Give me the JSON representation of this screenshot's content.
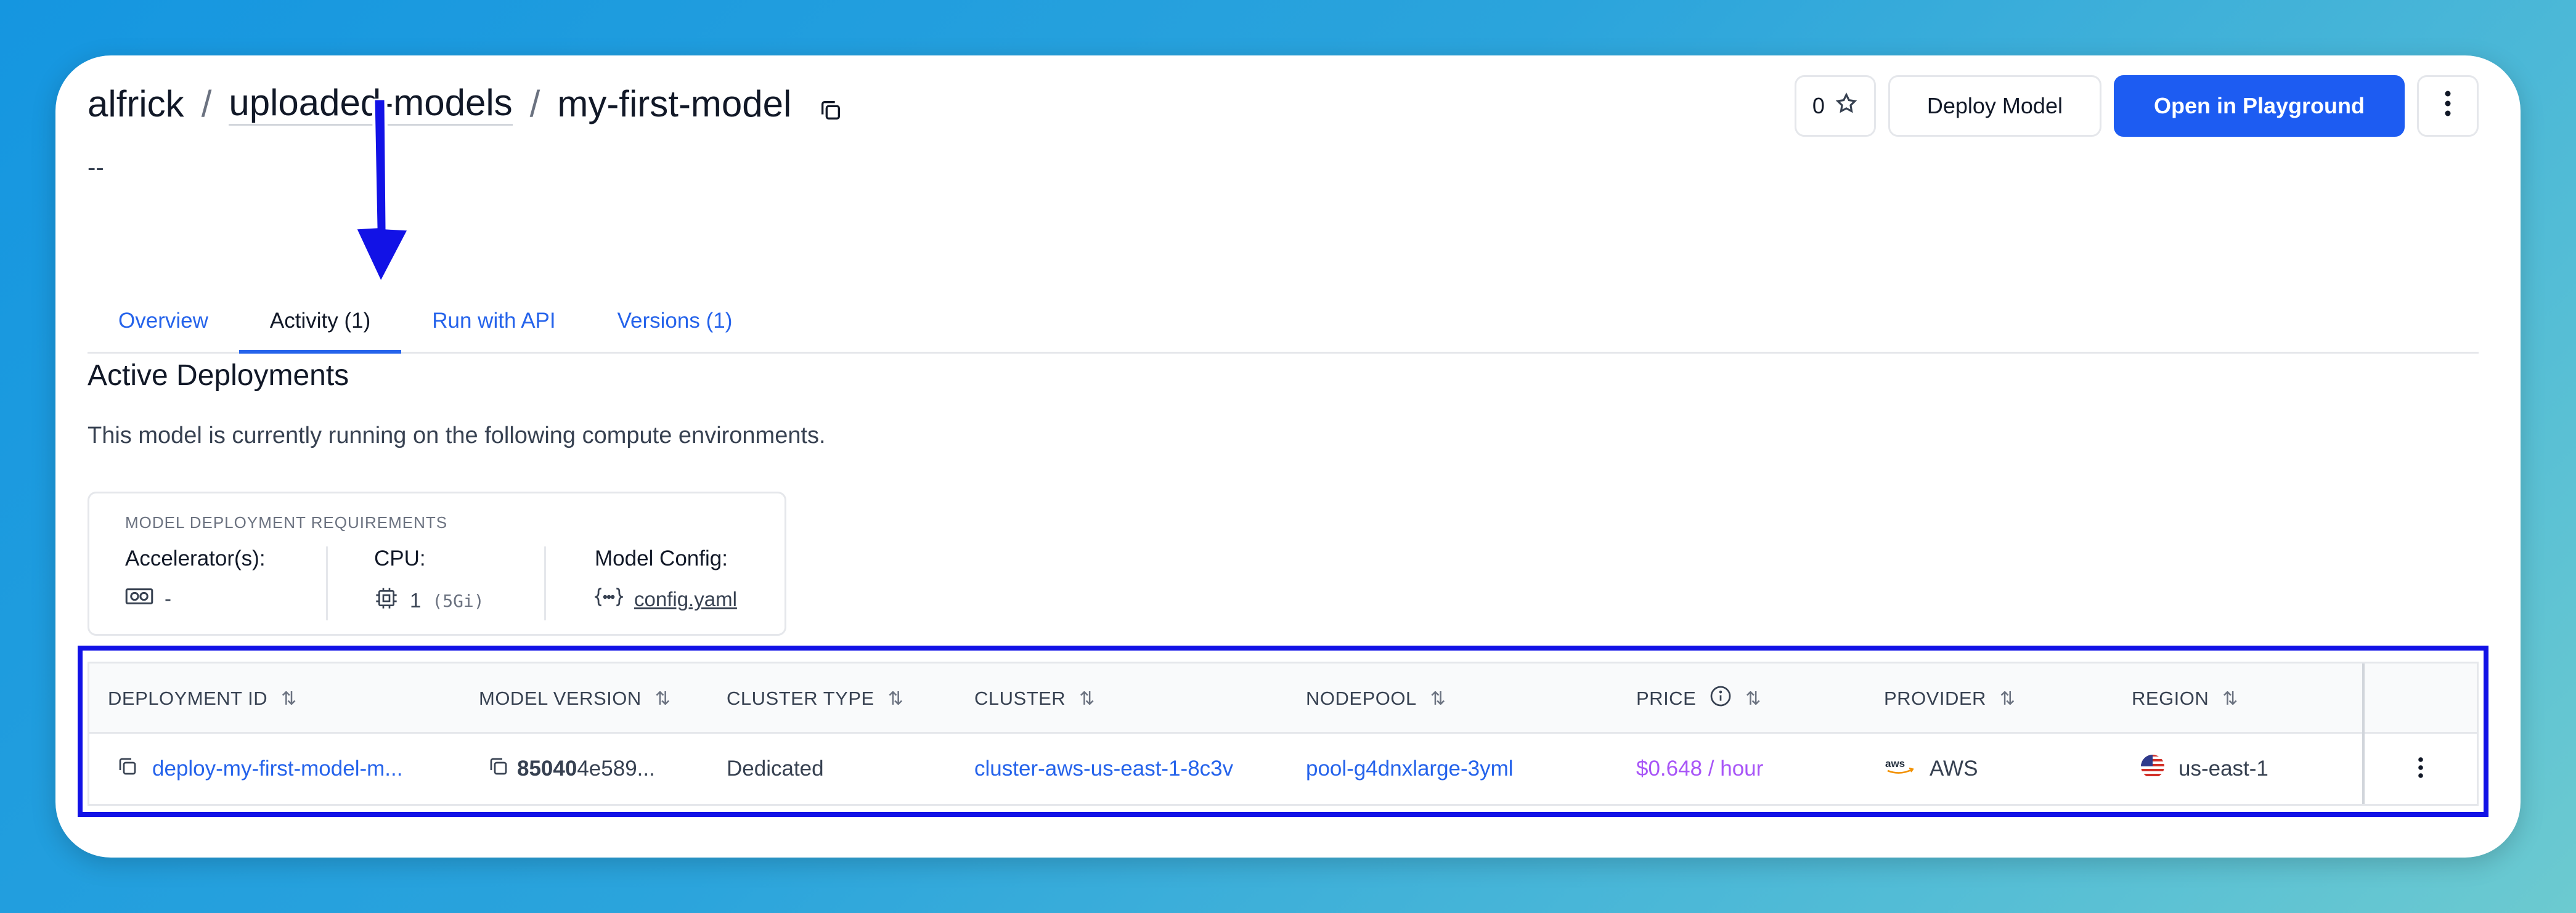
{
  "breadcrumb": {
    "owner": "alfrick",
    "app": "uploaded-models",
    "model": "my-first-model",
    "sep1": "/",
    "sep2": "/"
  },
  "description": "--",
  "header_actions": {
    "star_count": "0",
    "deploy_label": "Deploy Model",
    "playground_label": "Open in Playground"
  },
  "tabs": [
    {
      "label": "Overview",
      "active": false
    },
    {
      "label": "Activity (1)",
      "active": true
    },
    {
      "label": "Run with API",
      "active": false
    },
    {
      "label": "Versions (1)",
      "active": false
    }
  ],
  "section": {
    "title": "Active Deployments",
    "subtitle": "This model is currently running on the following compute environments."
  },
  "requirements": {
    "heading": "MODEL DEPLOYMENT REQUIREMENTS",
    "accelerator_label": "Accelerator(s):",
    "accelerator_value": "-",
    "cpu_label": "CPU:",
    "cpu_value": "1",
    "cpu_mem": "(5Gi)",
    "config_label": "Model Config:",
    "config_value": "config.yaml"
  },
  "table": {
    "columns": [
      "DEPLOYMENT ID",
      "MODEL VERSION",
      "CLUSTER TYPE",
      "CLUSTER",
      "NODEPOOL",
      "PRICE",
      "PROVIDER",
      "REGION"
    ],
    "rows": [
      {
        "deployment_id": "deploy-my-first-model-m...",
        "version_bold": "85040",
        "version_rest": "4e589...",
        "cluster_type": "Dedicated",
        "cluster": "cluster-aws-us-east-1-8c3v",
        "nodepool": "pool-g4dnxlarge-3yml",
        "price": "$0.648 / hour",
        "provider": "AWS",
        "provider_logo": "aws",
        "region": "us-east-1"
      }
    ]
  },
  "colors": {
    "accent": "#1d5cf2",
    "link": "#2563eb",
    "price": "#a855f7",
    "annotation": "#1212e6"
  }
}
